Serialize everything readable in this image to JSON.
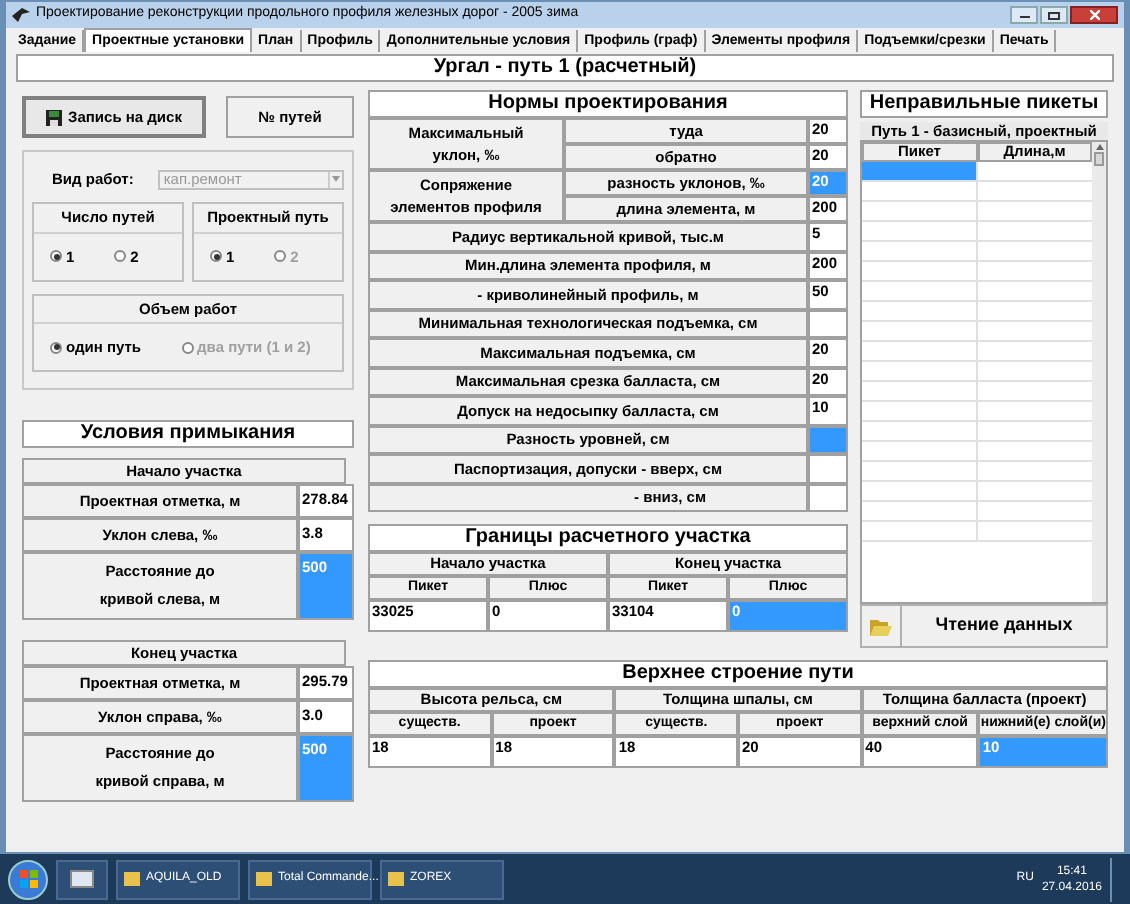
{
  "window": {
    "title": "Проектирование реконструкции продольного профиля железных дорог - 2005 зима"
  },
  "tabs": [
    {
      "label": "Задание",
      "selected": false
    },
    {
      "label": "Проектные установки",
      "selected": true
    },
    {
      "label": "План",
      "selected": false
    },
    {
      "label": "Профиль",
      "selected": false
    },
    {
      "label": "Дополнительные условия",
      "selected": false
    },
    {
      "label": "Профиль (граф)",
      "selected": false
    },
    {
      "label": "Элементы профиля",
      "selected": false
    },
    {
      "label": "Подъемки/срезки",
      "selected": false
    },
    {
      "label": "Печать",
      "selected": false
    }
  ],
  "header": "Ургал -  путь 1 (расчетный)",
  "toolbar": {
    "save_button": "Запись на диск",
    "tracks_button": "№ путей"
  },
  "work_type": {
    "label": "Вид работ:",
    "value": "кап.ремонт",
    "disabled": true
  },
  "track_count": {
    "title": "Число путей",
    "options": [
      {
        "label": "1",
        "selected": true,
        "disabled": false
      },
      {
        "label": "2",
        "selected": false,
        "disabled": false
      }
    ]
  },
  "design_track": {
    "title": "Проектный путь",
    "options": [
      {
        "label": "1",
        "selected": true,
        "disabled": false
      },
      {
        "label": "2",
        "selected": false,
        "disabled": true
      }
    ]
  },
  "work_scope": {
    "title": "Объем работ",
    "options": [
      {
        "label": "один путь",
        "selected": true,
        "disabled": false
      },
      {
        "label": "два пути (1 и 2)",
        "selected": false,
        "disabled": true
      }
    ]
  },
  "junction": {
    "title": "Условия примыкания",
    "sections": [
      {
        "title": "Начало участка",
        "rows": [
          {
            "label": "Проектная отметка, м",
            "value": "278.84",
            "selected": false
          },
          {
            "label": "Уклон слева, ‰",
            "value": "3.8",
            "selected": false
          },
          {
            "label": "Расстояние до\nкривой слева, м",
            "value": "500",
            "selected": true
          }
        ]
      },
      {
        "title": "Конец участка",
        "rows": [
          {
            "label": "Проектная отметка, м",
            "value": "295.79",
            "selected": false
          },
          {
            "label": "Уклон справа, ‰",
            "value": "3.0",
            "selected": false
          },
          {
            "label": "Расстояние до\nкривой справа, м",
            "value": "500",
            "selected": true
          }
        ]
      }
    ]
  },
  "norms": {
    "title": "Нормы проектирования",
    "rows": [
      {
        "kind": "group",
        "label": "Максимальный\nуклон, ‰",
        "items": [
          {
            "label": "туда",
            "value": "20",
            "selected": false
          },
          {
            "label": "обратно",
            "value": "20",
            "selected": false
          }
        ]
      },
      {
        "kind": "group",
        "label": "Сопряжение\nэлементов профиля",
        "items": [
          {
            "label": "разность уклонов, ‰",
            "value": "20",
            "selected": true
          },
          {
            "label": "длина элемента, м",
            "value": "200",
            "selected": false
          }
        ]
      },
      {
        "kind": "single",
        "label": "Радиус вертикальной кривой, тыс.м",
        "value": "5",
        "selected": false
      },
      {
        "kind": "single",
        "label": "Мин.длина элемента профиля, м",
        "value": "200",
        "selected": false
      },
      {
        "kind": "single",
        "label": "- криволинейный профиль, м",
        "value": "50",
        "selected": false
      },
      {
        "kind": "single",
        "label": "Минимальная технологическая подъемка, см",
        "selected": false
      },
      {
        "kind": "single",
        "label": "Максимальная подъемка, см",
        "value": "20",
        "selected": false
      },
      {
        "kind": "single",
        "label": "Максимальная срезка балласта, см",
        "value": "20",
        "selected": false
      },
      {
        "kind": "single",
        "label": "Допуск на недосыпку балласта, см",
        "value": "10",
        "selected": false
      },
      {
        "kind": "single",
        "label": "Разность уровней, см",
        "selected": true
      },
      {
        "kind": "single",
        "label": "Паспортизация, допуски - вверх, см",
        "selected": false
      },
      {
        "kind": "sub",
        "label": "- вниз, см",
        "selected": false
      }
    ]
  },
  "bounds": {
    "title": "Границы расчетного участка",
    "groups": [
      {
        "label": "Начало участка",
        "columns": [
          {
            "label": "Пикет",
            "value": "33025",
            "selected": false
          },
          {
            "label": "Плюс",
            "value": "0",
            "selected": false
          }
        ]
      },
      {
        "label": "Конец участка",
        "columns": [
          {
            "label": "Пикет",
            "value": "33104",
            "selected": false
          },
          {
            "label": "Плюс",
            "value": "0",
            "selected": true
          }
        ]
      }
    ]
  },
  "bad_pickets": {
    "title": "Неправильные пикеты",
    "subtitle": "Путь 1 - базисный, проектный",
    "columns": [
      "Пикет",
      "Длина,м"
    ],
    "rows": [
      {
        "selected": true
      },
      {
        "selected": false
      }
    ]
  },
  "read_button": "Чтение данных",
  "superstructure": {
    "title": "Верхнее строение пути",
    "groups": [
      {
        "label": "Высота рельса, см",
        "columns": [
          {
            "label": "существ.",
            "value": "18",
            "selected": false
          },
          {
            "label": "проект",
            "value": "18",
            "selected": false
          }
        ]
      },
      {
        "label": "Толщина шпалы, см",
        "columns": [
          {
            "label": "существ.",
            "value": "18",
            "selected": false
          },
          {
            "label": "проект",
            "value": "20",
            "selected": false
          }
        ]
      },
      {
        "label": "Толщина балласта (проект)",
        "columns": [
          {
            "label": "верхний слой",
            "value": "40",
            "selected": false
          },
          {
            "label": "нижний(е) слой(и)",
            "value": "10",
            "selected": true
          }
        ]
      }
    ]
  },
  "taskbar": {
    "items": [
      {
        "label": "AQUILA_OLD"
      },
      {
        "label": "Total Commande..."
      },
      {
        "label": "ZOREX"
      }
    ],
    "language": "RU",
    "time": "15:41",
    "date": "27.04.2016"
  }
}
